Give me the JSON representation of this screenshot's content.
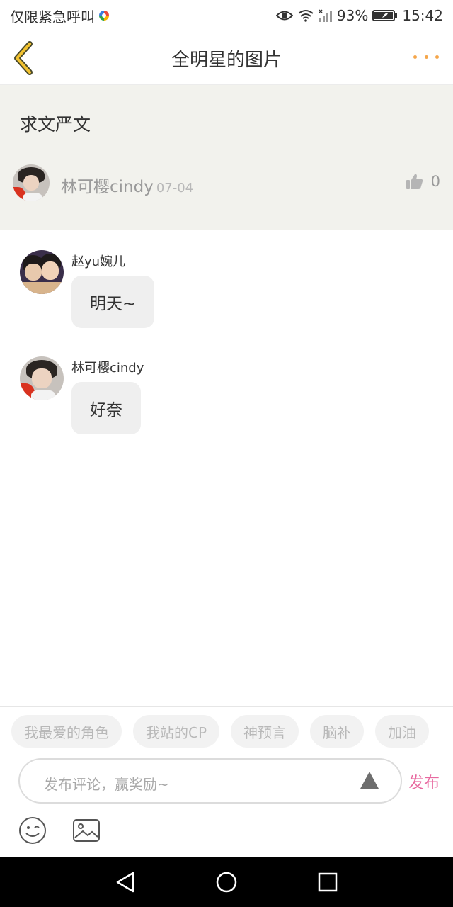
{
  "status_bar": {
    "carrier": "仅限紧急呼叫",
    "battery": "93%",
    "time": "15:42",
    "icons": [
      "eye-icon",
      "wifi-icon",
      "signal-icon",
      "battery-icon"
    ]
  },
  "header": {
    "title": "全明星的图片",
    "back_icon": "chevron-left-icon",
    "more_icon": "more-dots-icon",
    "accent_color": "#f5a64a"
  },
  "topic": {
    "title": "求文严文",
    "author": "林可樱cindy",
    "date": "07-04",
    "likes": "0"
  },
  "comments": [
    {
      "author": "赵yu婉儿",
      "text": "明天~"
    },
    {
      "author": "林可樱cindy",
      "text": "好奈"
    }
  ],
  "composer": {
    "chips": [
      "我最爱的角色",
      "我站的CP",
      "神预言",
      "脑补",
      "加油"
    ],
    "placeholder": "发布评论，赢奖励~",
    "publish_label": "发布",
    "publish_color": "#e86aa0"
  },
  "nav_bar": {
    "buttons": [
      "nav-back-icon",
      "nav-home-icon",
      "nav-recent-icon"
    ]
  }
}
